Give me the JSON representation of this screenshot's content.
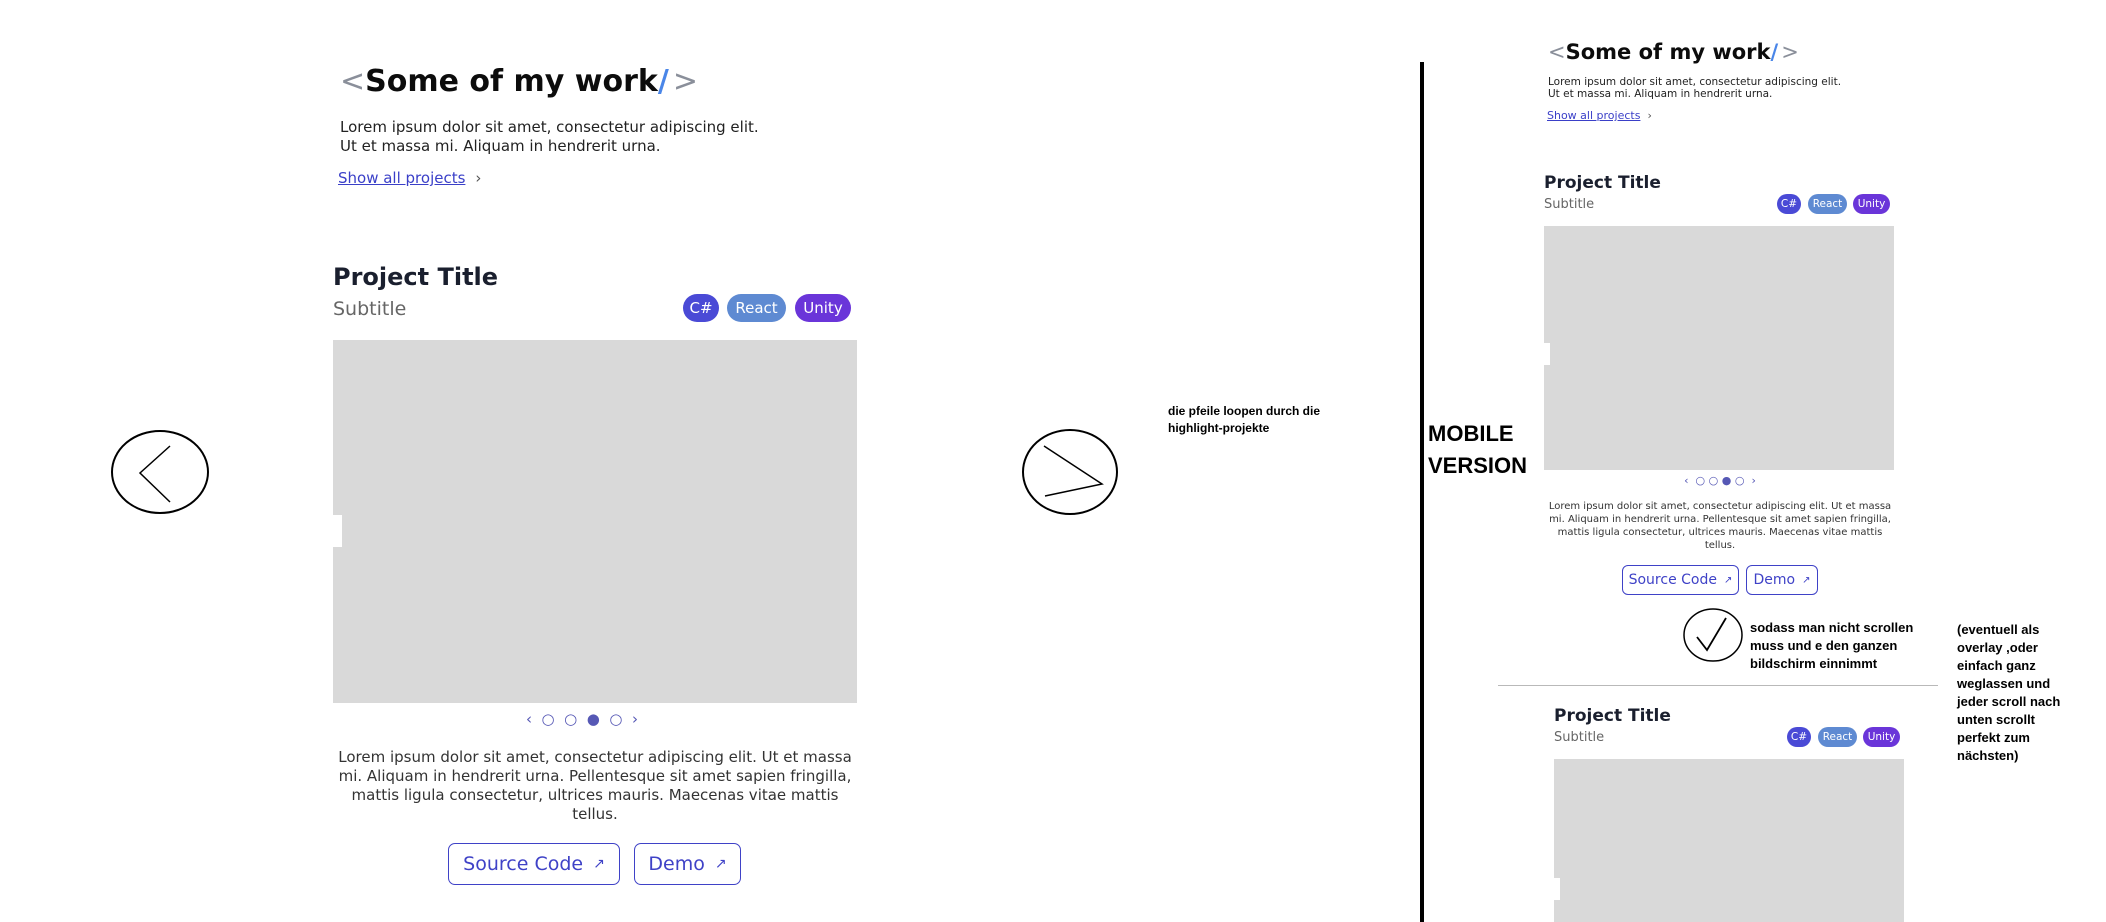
{
  "desktop": {
    "heading": {
      "open": "<",
      "text": "Some of my work",
      "slash": "/",
      "close": ">"
    },
    "lead_line1": "Lorem ipsum dolor sit amet, consectetur adipiscing elit.",
    "lead_line2": "Ut et massa mi. Aliquam in hendrerit urna.",
    "show_all_label": "Show all projects",
    "chevron": "›",
    "project": {
      "title": "Project Title",
      "subtitle": "Subtitle",
      "tags": [
        {
          "label": "C#",
          "color": "#4a4ad6"
        },
        {
          "label": "React",
          "color": "#5e8ad2"
        },
        {
          "label": "Unity",
          "color": "#6a35d9"
        }
      ],
      "carousel": {
        "prev": "‹",
        "dots": [
          "○",
          "○",
          "●",
          "○"
        ],
        "next": "›",
        "active_index": 2
      },
      "description": "Lorem ipsum dolor sit amet, consectetur adipiscing elit. Ut et massa mi. Aliquam in hendrerit urna. Pellentesque sit amet sapien fringilla, mattis ligula consectetur, ultrices mauris. Maecenas vitae mattis tellus.",
      "source_label": "Source Code",
      "demo_label": "Demo",
      "external_arrow": "↗"
    },
    "annotation_arrows": "die pfeile loopen durch die highlight-projekte"
  },
  "mobile": {
    "label": "MOBILE VERSION",
    "heading": {
      "open": "<",
      "text": "Some of my work",
      "slash": "/",
      "close": ">"
    },
    "lead_line1": "Lorem ipsum dolor sit amet, consectetur adipiscing elit.",
    "lead_line2": "Ut et massa mi. Aliquam in hendrerit urna.",
    "show_all_label": "Show all projects",
    "chevron": "›",
    "project": {
      "title": "Project Title",
      "subtitle": "Subtitle",
      "tags": [
        {
          "label": "C#",
          "color": "#4a4ad6"
        },
        {
          "label": "React",
          "color": "#5e8ad2"
        },
        {
          "label": "Unity",
          "color": "#6a35d9"
        }
      ],
      "carousel": {
        "prev": "‹",
        "dots": [
          "○",
          "○",
          "●",
          "○"
        ],
        "next": "›",
        "active_index": 2
      },
      "description": "Lorem ipsum dolor sit amet, consectetur adipiscing elit. Ut et massa mi. Aliquam in hendrerit urna. Pellentesque sit amet sapien fringilla, mattis ligula consectetur, ultrices mauris. Maecenas vitae mattis tellus.",
      "source_label": "Source Code",
      "demo_label": "Demo",
      "external_arrow": "↗"
    },
    "project2": {
      "title": "Project Title",
      "subtitle": "Subtitle",
      "tags": [
        {
          "label": "C#",
          "color": "#4a4ad6"
        },
        {
          "label": "React",
          "color": "#5e8ad2"
        },
        {
          "label": "Unity",
          "color": "#6a35d9"
        }
      ]
    },
    "annotation_check": "sodass man nicht scrollen muss und e den ganzen bildschirm einnimmt",
    "annotation_overlay": "(eventuell als overlay ,oder einfach ganz weglassen und jeder scroll nach unten scrollt perfekt zum nächsten)"
  }
}
